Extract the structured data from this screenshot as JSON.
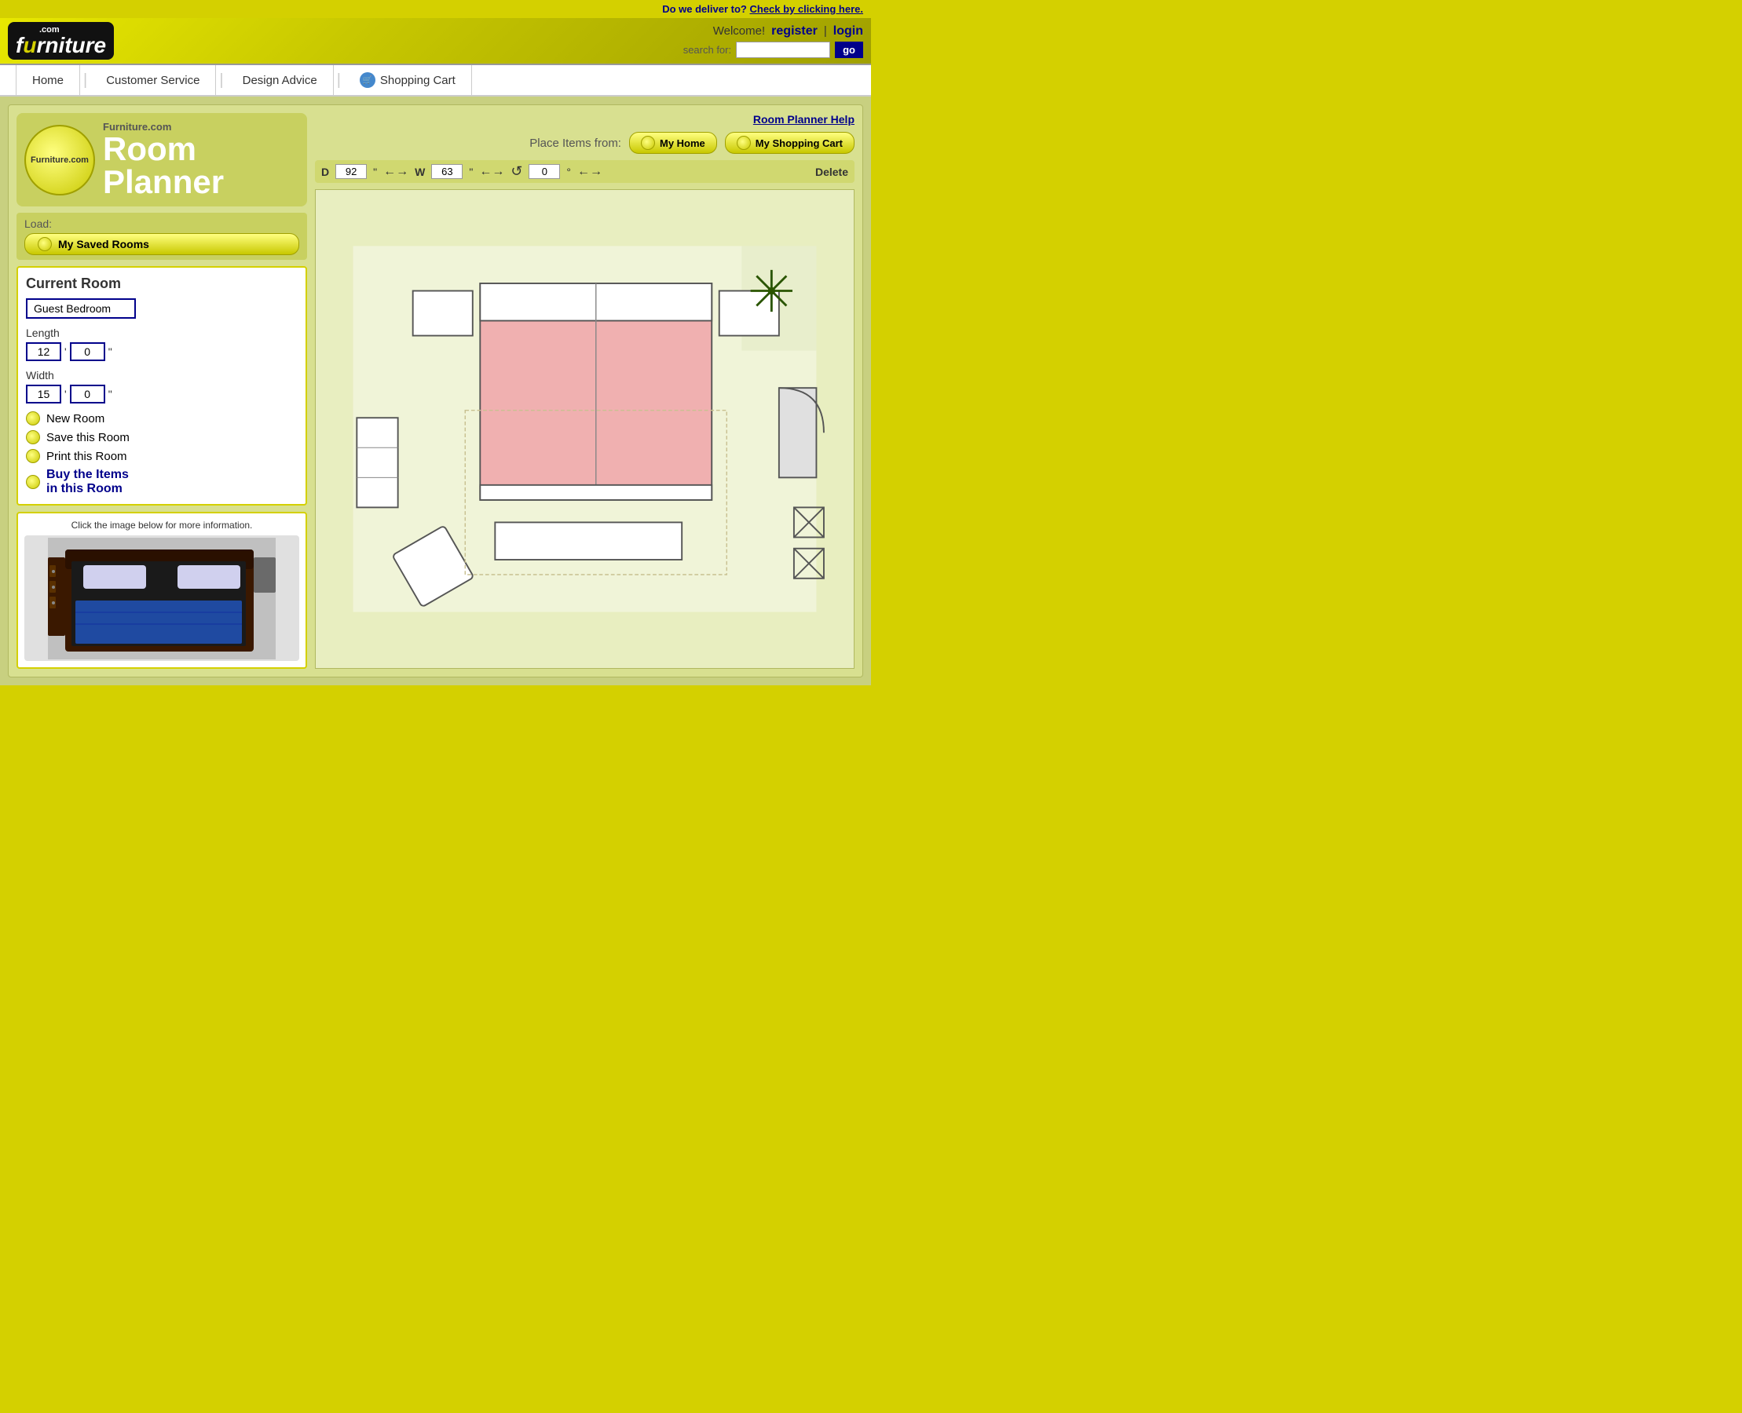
{
  "delivery": {
    "question": "Do we deliver to?",
    "action": "Check by clicking here."
  },
  "header": {
    "logo_com": ".com",
    "logo_name": "furniture",
    "welcome": "Welcome!",
    "register": "register",
    "separator": "|",
    "login": "login",
    "search_label": "search for:",
    "search_placeholder": "",
    "go_button": "go"
  },
  "navbar": {
    "items": [
      {
        "label": "Home",
        "id": "home"
      },
      {
        "label": "Customer Service",
        "id": "customer-service"
      },
      {
        "label": "Design Advice",
        "id": "design-advice"
      },
      {
        "label": "Shopping Cart",
        "id": "shopping-cart"
      }
    ]
  },
  "planner": {
    "help_link": "Room Planner Help",
    "logo_small": "Furniture.com",
    "logo_big_1": "Room",
    "logo_big_2": "Planner",
    "load_label": "Load:",
    "load_button": "My Saved Rooms",
    "place_label": "Place Items from:",
    "place_home": "My Home",
    "place_cart": "My Shopping Cart",
    "dimension_bar": {
      "d_label": "D",
      "d_value": "92",
      "d_unit": "\"",
      "w_label": "W",
      "w_value": "63",
      "w_unit": "\"",
      "rotate_value": "0",
      "rotate_unit": "°",
      "delete_label": "Delete"
    },
    "current_room": {
      "title": "Current Room",
      "name": "Guest Bedroom",
      "length_label": "Length",
      "length_ft": "12",
      "length_in": "0",
      "length_unit": "\"",
      "width_label": "Width",
      "width_ft": "15",
      "width_in": "0",
      "width_unit": "\""
    },
    "actions": {
      "new_room": "New Room",
      "save_room": "Save this Room",
      "print_room": "Print this Room",
      "buy_items": "Buy the Items\nin this Room"
    },
    "image_section": {
      "title": "Click the image below for more information."
    }
  }
}
